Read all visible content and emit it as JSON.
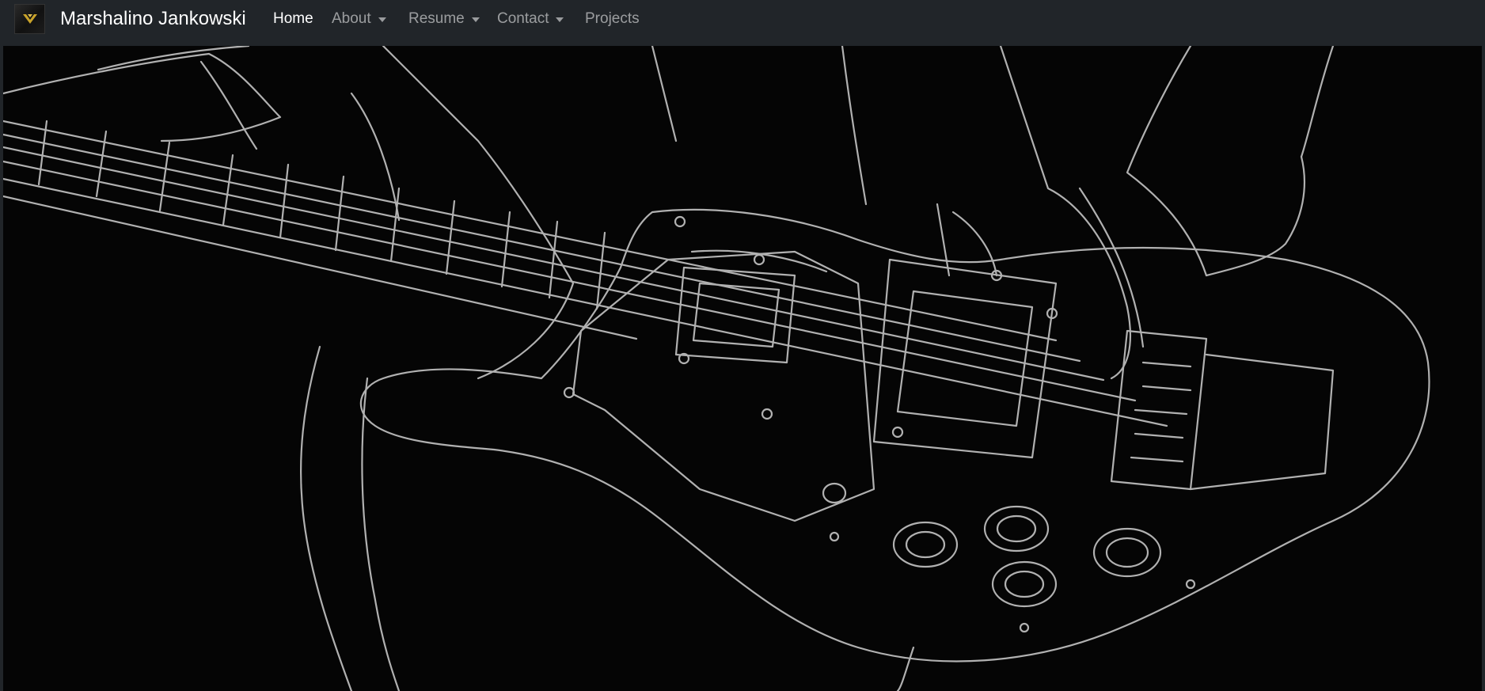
{
  "navbar": {
    "brand": {
      "name": "Marshalino Jankowski",
      "logo_icon": "gold-chevron-logo-icon"
    },
    "items": [
      {
        "label": "Home",
        "active": true,
        "dropdown": false
      },
      {
        "label": "About",
        "active": false,
        "dropdown": true
      },
      {
        "label": "Resume",
        "active": false,
        "dropdown": true
      },
      {
        "label": "Contact",
        "active": false,
        "dropdown": true
      },
      {
        "label": "Projects",
        "active": false,
        "dropdown": false
      }
    ]
  },
  "hero": {
    "image_icon": "bass-guitar-line-art-icon",
    "background": "#050505",
    "line_color": "#cfcfcf"
  },
  "colors": {
    "navbar_bg": "#212529",
    "nav_active": "#ffffff",
    "nav_inactive": "#8c8f91",
    "logo_accent": "#c8a22a"
  }
}
